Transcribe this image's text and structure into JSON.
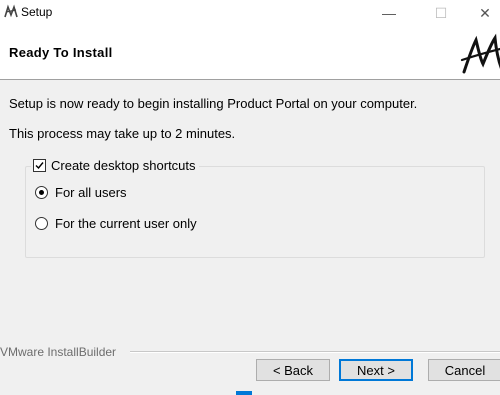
{
  "window": {
    "title": "Setup",
    "minimize_glyph": "—",
    "maximize_glyph": "☐",
    "close_glyph": "✕"
  },
  "header": {
    "title": "Ready To Install",
    "logo_icon": "installbuilder-logo-icon"
  },
  "body": {
    "line1": "Setup is now ready to begin installing Product Portal on your computer.",
    "line2": "This process may take up to 2 minutes."
  },
  "options": {
    "desktop_shortcuts": {
      "label": "Create desktop shortcuts",
      "checked": true
    },
    "radios": [
      {
        "label": "For all users",
        "selected": true
      },
      {
        "label": "For the current user only",
        "selected": false
      }
    ]
  },
  "footer": {
    "brand": "VMware InstallBuilder",
    "back_label": "< Back",
    "next_label": "Next >",
    "cancel_label": "Cancel"
  },
  "colors": {
    "accent": "#0078d7",
    "window_bg": "#f0f0f0",
    "header_bg": "#ffffff"
  }
}
